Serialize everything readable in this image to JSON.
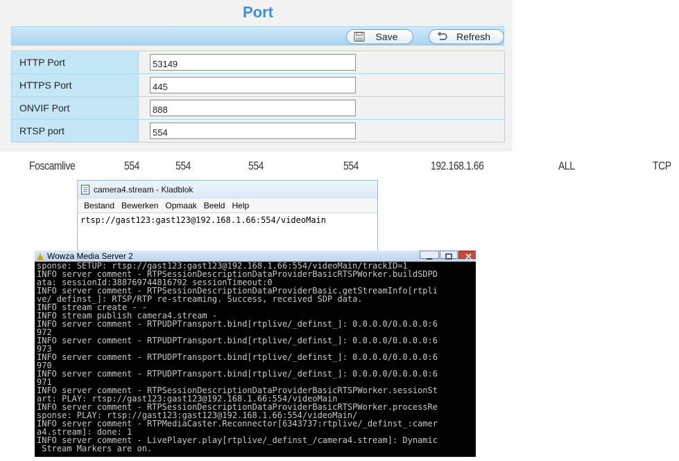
{
  "port_settings": {
    "title": "Port",
    "save_label": "Save",
    "refresh_label": "Refresh",
    "rows": [
      {
        "label": "HTTP Port",
        "value": "53149"
      },
      {
        "label": "HTTPS Port",
        "value": "445"
      },
      {
        "label": "ONVIF Port",
        "value": "888"
      },
      {
        "label": "RTSP port",
        "value": "554"
      }
    ]
  },
  "values_row": {
    "name": "Foscamlive",
    "port_1": "554",
    "port_2": "554",
    "port_3": "554",
    "port_4": "554",
    "ip": "192.168.1.66",
    "scope": "ALL",
    "protocol": "TCP"
  },
  "notepad": {
    "title": "camera4.stream - Kladblok",
    "menu": [
      "Bestand",
      "Bewerken",
      "Opmaak",
      "Beeld",
      "Help"
    ],
    "content": "rtsp://gast123:gast123@192.168.1.66:554/videoMain"
  },
  "console": {
    "title": "Wowza Media Server 2",
    "lines": [
      "sponse: SETUP: rtsp://gast123:gast123@192.168.1.66:554/videoMain/trackID=1",
      "INFO server comment - RTPSessionDescriptionDataProviderBasicRTSPWorker.buildSDPD",
      "ata: sessionId:388769744816792 sessionTimeout:0",
      "INFO server comment - RTPSessionDescriptionDataProviderBasic.getStreamInfo[rtpli",
      "ve/_definst_]: RTSP/RTP re-streaming. Success, received SDP data.",
      "INFO stream create - -",
      "INFO stream publish camera4.stream -",
      "INFO server comment - RTPUDPTransport.bind[rtplive/_definst_]: 0.0.0.0/0.0.0.0:6",
      "972",
      "INFO server comment - RTPUDPTransport.bind[rtplive/_definst_]: 0.0.0.0/0.0.0.0:6",
      "973",
      "INFO server comment - RTPUDPTransport.bind[rtplive/_definst_]: 0.0.0.0/0.0.0.0:6",
      "970",
      "INFO server comment - RTPUDPTransport.bind[rtplive/_definst_]: 0.0.0.0/0.0.0.0:6",
      "971",
      "INFO server comment - RTPSessionDescriptionDataProviderBasicRTSPWorker.sessionSt",
      "art: PLAY: rtsp://gast123:gast123@192.168.1.66:554/videoMain",
      "INFO server comment - RTPSessionDescriptionDataProviderBasicRTSPWorker.processRe",
      "sponse: PLAY: rtsp://gast123:gast123@192.168.1.66:554/videoMain/",
      "INFO server comment - RTPMediaCaster.Reconnector[6343737:rtplive/_definst_:camer",
      "a4.stream]: done: 1",
      "INFO server comment - LivePlayer.play[rtplive/_definst_/camera4.stream]: Dynamic",
      " Stream Markers are on."
    ]
  }
}
